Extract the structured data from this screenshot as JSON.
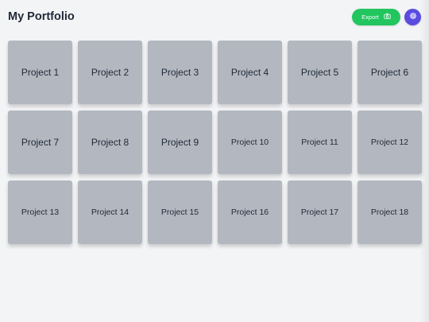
{
  "header": {
    "title": "My Portfolio",
    "export_label": "Export",
    "export_icon": "camera-icon",
    "settings_icon": "gear-icon"
  },
  "colors": {
    "background": "#f3f4f6",
    "card": "#b3b8c0",
    "export_button": "#22c55e",
    "settings_button": "#5b4ce0",
    "text": "#1f2937"
  },
  "projects": [
    {
      "label": "Project 1"
    },
    {
      "label": "Project 2"
    },
    {
      "label": "Project 3"
    },
    {
      "label": "Project 4"
    },
    {
      "label": "Project 5"
    },
    {
      "label": "Project 6"
    },
    {
      "label": "Project 7"
    },
    {
      "label": "Project 8"
    },
    {
      "label": "Project 9"
    },
    {
      "label": "Project 10"
    },
    {
      "label": "Project 11"
    },
    {
      "label": "Project 12"
    },
    {
      "label": "Project 13"
    },
    {
      "label": "Project 14"
    },
    {
      "label": "Project 15"
    },
    {
      "label": "Project 16"
    },
    {
      "label": "Project 17"
    },
    {
      "label": "Project 18"
    }
  ]
}
